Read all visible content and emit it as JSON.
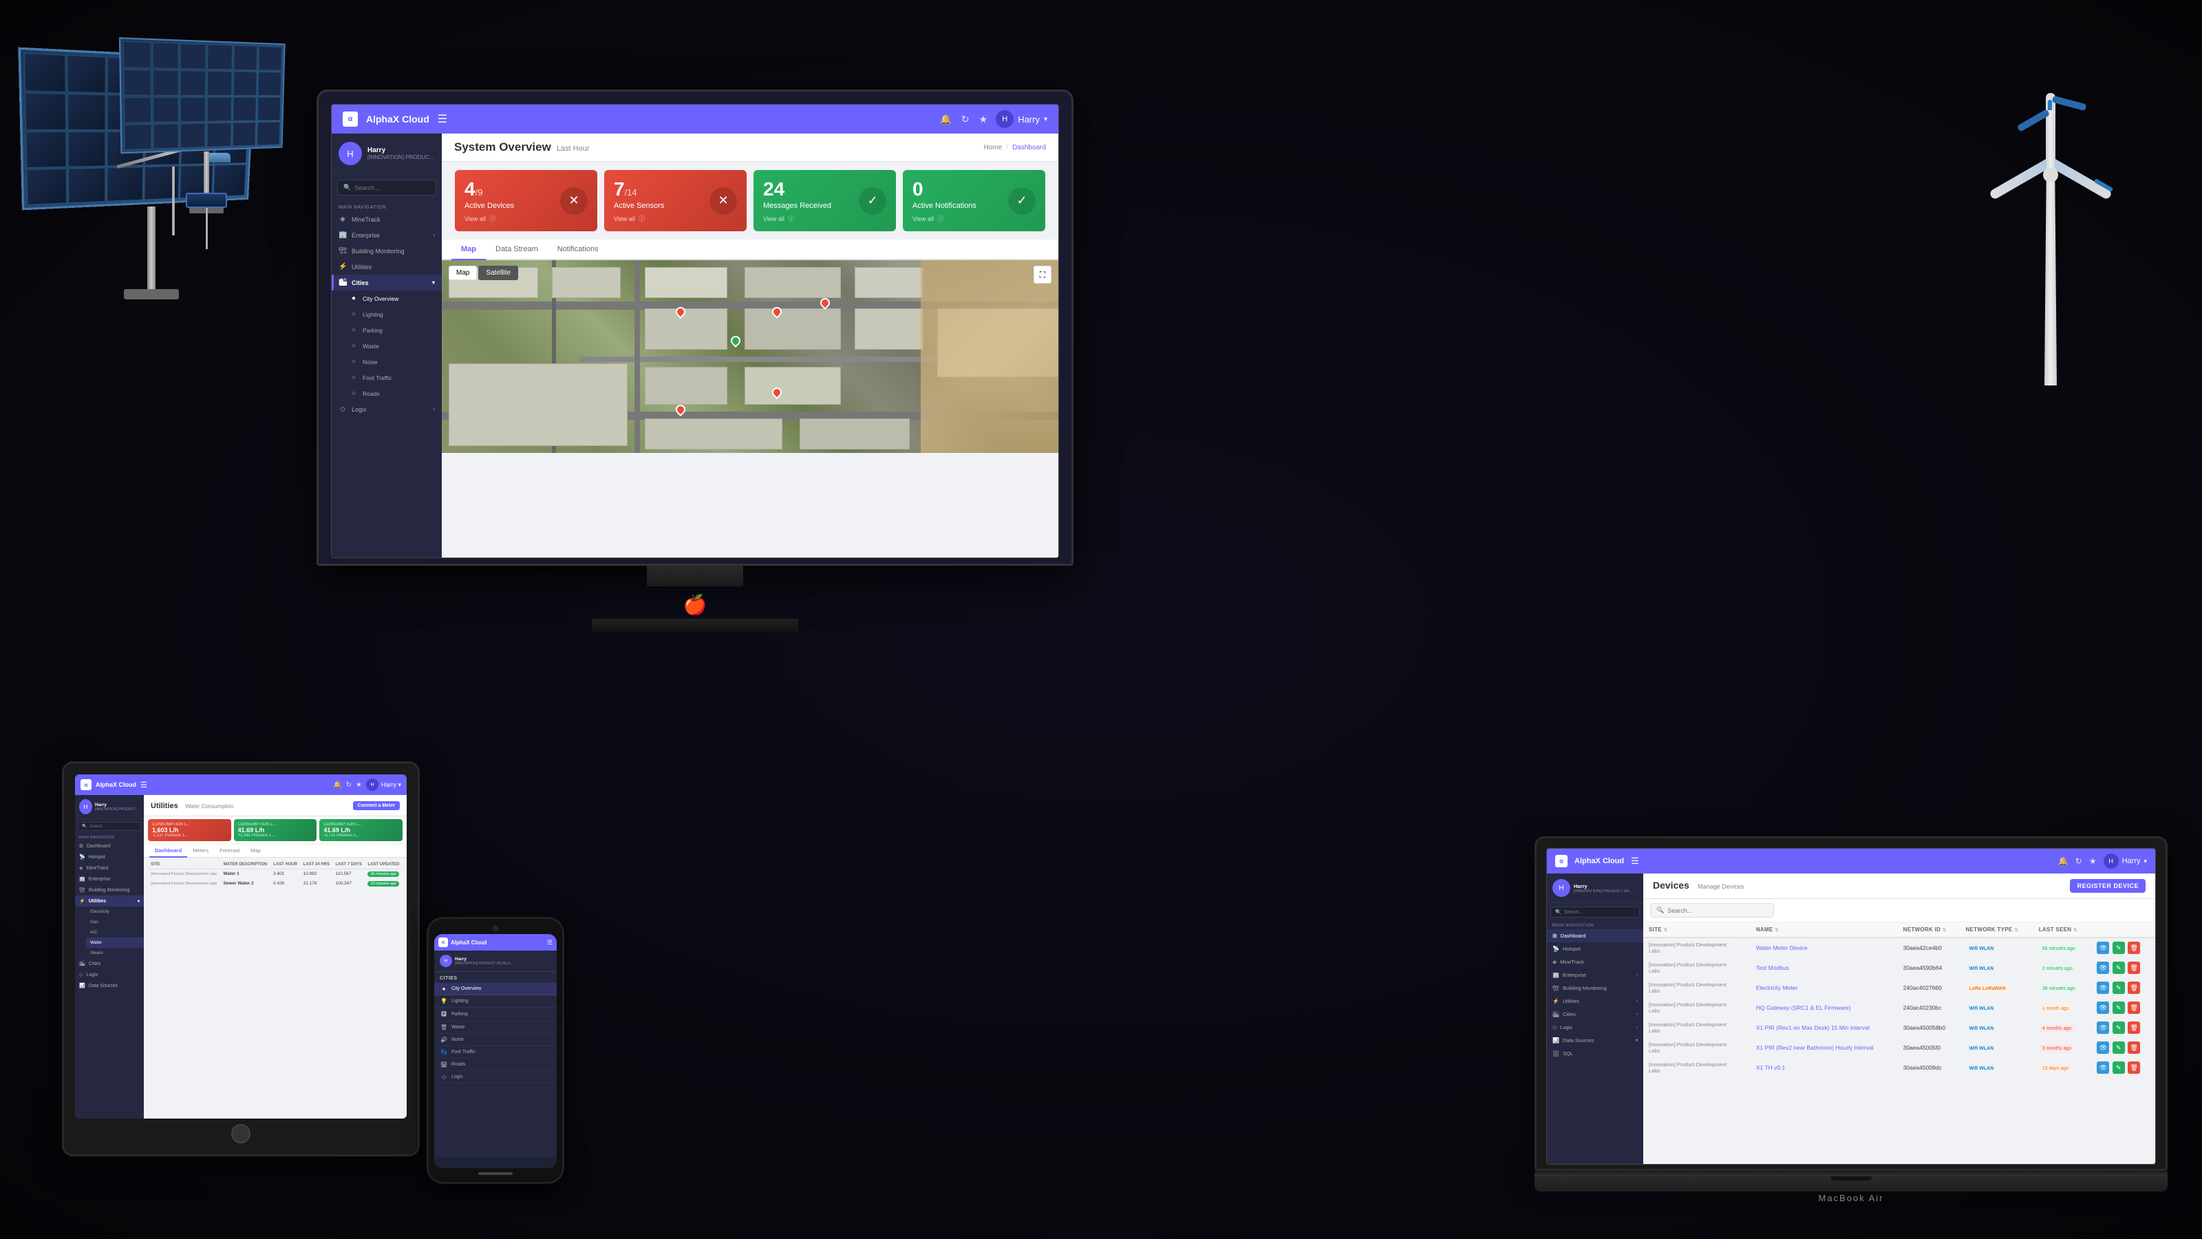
{
  "app": {
    "brand": "AlphaX Cloud",
    "logo_letter": "α",
    "user": "Harry",
    "menu_icon": "☰",
    "bell_icon": "🔔",
    "refresh_icon": "↻",
    "star_icon": "★",
    "search_placeholder": "Search..."
  },
  "monitor": {
    "page_title": "System Overview",
    "page_subtitle": "Last Hour",
    "breadcrumb": {
      "home": "Home",
      "current": "Dashboard"
    },
    "stat_cards": [
      {
        "number": "4",
        "denom": "/9",
        "label": "Active Devices",
        "view_all": "View all",
        "type": "red",
        "icon": "✕"
      },
      {
        "number": "7",
        "denom": "/14",
        "label": "Active Sensors",
        "view_all": "View all",
        "type": "red",
        "icon": "✕"
      },
      {
        "number": "24",
        "denom": "",
        "label": "Messages Received",
        "view_all": "View all",
        "type": "green",
        "icon": "✓"
      },
      {
        "number": "0",
        "denom": "",
        "label": "Active Notifications",
        "view_all": "View all",
        "type": "green",
        "icon": "✓"
      }
    ],
    "tabs": [
      "Map",
      "Data Stream",
      "Notifications"
    ],
    "active_tab": "Map",
    "map_tabs": [
      "Map",
      "Satellite"
    ],
    "active_map_tab": "Satellite",
    "sidebar": {
      "profile_name": "Harry",
      "profile_org": "[INNOVATION] PRODUCT DEVELO...",
      "nav_items": [
        {
          "label": "MineTrack",
          "icon": "◈"
        },
        {
          "label": "Enterprise",
          "icon": "🏢",
          "has_arrow": true
        },
        {
          "label": "Building Monitoring",
          "icon": "🏗"
        },
        {
          "label": "Utilities",
          "icon": "⚡"
        },
        {
          "label": "Cities",
          "icon": "🏙",
          "active": true,
          "has_arrow": true
        },
        {
          "label": "City Overview",
          "icon": "●",
          "sub": true,
          "active_sub": true
        },
        {
          "label": "Lighting",
          "icon": "○",
          "sub": true
        },
        {
          "label": "Parking",
          "icon": "○",
          "sub": true
        },
        {
          "label": "Waste",
          "icon": "○",
          "sub": true
        },
        {
          "label": "Noise",
          "icon": "○",
          "sub": true
        },
        {
          "label": "Foot Traffic",
          "icon": "○",
          "sub": true
        },
        {
          "label": "Roads",
          "icon": "○",
          "sub": true
        },
        {
          "label": "Logix",
          "icon": "◇",
          "has_arrow": true
        }
      ],
      "nav_label": "MAIN NAVIGATION"
    }
  },
  "laptop": {
    "page_title": "Devices",
    "page_subtitle": "Manage Devices",
    "register_btn": "REGISTER DEVICE",
    "table_headers": [
      "Site",
      "Name",
      "Network ID",
      "Network Type",
      "Last Seen",
      ""
    ],
    "devices": [
      {
        "site": "[Innovation] Product Development Labs",
        "name": "Water Meter Device",
        "network_id": "30aea42ce4b0",
        "network_type": "Wifi WLAN",
        "network_type_badge": "wifi",
        "last_seen": "56 minutes ago",
        "last_seen_type": "green"
      },
      {
        "site": "[Innovation] Product Development Labs",
        "name": "Test Modbus",
        "network_id": "30aea4590b64",
        "network_type": "Wifi WLAN",
        "network_type_badge": "wifi",
        "last_seen": "2 minutes ago",
        "last_seen_type": "green"
      },
      {
        "site": "[Innovation] Product Development Labs",
        "name": "Electricity Meter",
        "network_id": "240ac4027660",
        "network_type": "LoRa LoRaWAN",
        "network_type_badge": "lora",
        "last_seen": "38 minutes ago",
        "last_seen_type": "green"
      },
      {
        "site": "[Innovation] Product Development Labs",
        "name": "HQ Gateway (SRC1 & EL Firmware)",
        "network_id": "240ac40230bc",
        "network_type": "Wifi WLAN",
        "network_type_badge": "wifi",
        "last_seen": "1 month ago",
        "last_seen_type": "orange"
      },
      {
        "site": "[Innovation] Product Development Labs",
        "name": "X1 PIR (Rev1 on Max Desk) 15 Min Interval",
        "network_id": "30aea450058b0",
        "network_type": "Wifi WLAN",
        "network_type_badge": "wifi",
        "last_seen": "4 months ago",
        "last_seen_type": "red"
      },
      {
        "site": "[Innovation] Product Development Labs",
        "name": "X1 PIR (Rev2 near Bathroom) Hourly Interval",
        "network_id": "30aea45005f0",
        "network_type": "Wifi WLAN",
        "network_type_badge": "wifi",
        "last_seen": "3 months ago",
        "last_seen_type": "red"
      },
      {
        "site": "[Innovation] Product Development Labs",
        "name": "X1 TH v0.1",
        "network_id": "30aea45009dc",
        "network_type": "Wifi WLAN",
        "network_type_badge": "wifi",
        "last_seen": "13 days ago",
        "last_seen_type": "orange"
      }
    ],
    "sidebar": {
      "profile_name": "Harry",
      "profile_org": "[INNOVATION] PRODUCT DEVE...",
      "nav_items": [
        {
          "label": "Dashboard",
          "icon": "⊞",
          "active": true
        },
        {
          "label": "Hotspot",
          "icon": "📡"
        },
        {
          "label": "MineTrack",
          "icon": "◈"
        },
        {
          "label": "Enterprise",
          "icon": "🏢",
          "has_arrow": true
        },
        {
          "label": "Building Monitoring",
          "icon": "🏗"
        },
        {
          "label": "Utilities",
          "icon": "⚡",
          "has_arrow": true
        },
        {
          "label": "Cities",
          "icon": "🏙",
          "has_arrow": true
        },
        {
          "label": "Logix",
          "icon": "◇",
          "has_arrow": true
        },
        {
          "label": "Data Sources",
          "icon": "📊",
          "has_arrow": true
        },
        {
          "label": "SQL",
          "icon": "🗄"
        }
      ]
    }
  },
  "tablet": {
    "page_title": "Utilities",
    "page_subtitle": "Water Consumption",
    "connect_meter_btn": "Connect a Meter",
    "tabs": [
      "Dashboard",
      "Meters",
      "Forecast",
      "Map"
    ],
    "active_tab": "Dashboard",
    "consumption_cards": [
      {
        "label": "CONSUMPTION L...",
        "value": "1,603 L/h",
        "prev": "-1.227 Previous 1...",
        "type": "red"
      },
      {
        "label": "CONSUMPTION L...",
        "value": "41.69 L/h",
        "prev": "+1.381 Previous 1...",
        "type": "green"
      },
      {
        "label": "CONSUMPTION L...",
        "value": "41.69 L/h",
        "prev": "-5.715 Previous 1...",
        "type": "green"
      }
    ],
    "water_tabs": [
      "Dashboard",
      "Meters",
      "Forecast",
      "Map"
    ],
    "table_headers": [
      "Site",
      "Water Description",
      "Last Hour",
      "Last 24 Hrs",
      "Last 7 Days",
      "Last Updated"
    ],
    "water_rows": [
      {
        "site": "[Innovation] Product Development Labs",
        "description": "Water 1",
        "last_hour": "3.601",
        "last_24h": "10.982",
        "last_7d": "110,567",
        "last_updated": "26 minutes ago"
      },
      {
        "site": "[Innovation] Product Development Labs",
        "description": "Sewer Water 2",
        "last_hour": "0.430",
        "last_24h": "31.178",
        "last_7d": "100,347",
        "last_updated": "23 minutes ago"
      }
    ],
    "sidebar": {
      "profile_name": "Harry",
      "profile_org": "[INNOVATION] PRODUCT DEVELO...",
      "nav_items": [
        {
          "label": "Dashboard",
          "icon": "⊞"
        },
        {
          "label": "Hotspot",
          "icon": "📡"
        },
        {
          "label": "MineTrack",
          "icon": "◈"
        },
        {
          "label": "Enterprise",
          "icon": "🏢"
        },
        {
          "label": "Building Monitoring",
          "icon": "🏗"
        },
        {
          "label": "Utilities",
          "icon": "⚡",
          "active": true,
          "sub_items": [
            "Electricity",
            "Gas",
            "A/C",
            "Water",
            "Steam"
          ]
        },
        {
          "label": "Cities",
          "icon": "🏙"
        },
        {
          "label": "Logix",
          "icon": "◇"
        },
        {
          "label": "Data Sources",
          "icon": "📊"
        }
      ]
    }
  },
  "phone": {
    "brand": "AlphaX Cloud",
    "user": "Harry",
    "nav_items": [
      {
        "label": "Cities",
        "icon": "🏙",
        "is_section": true
      },
      {
        "label": "City Overview",
        "icon": "●",
        "active": true
      },
      {
        "label": "Lighting",
        "icon": "💡"
      },
      {
        "label": "Parking",
        "icon": "🅿"
      },
      {
        "label": "Waste",
        "icon": "🗑"
      },
      {
        "label": "Noise",
        "icon": "🔊"
      },
      {
        "label": "Foot Traffic",
        "icon": "👣"
      },
      {
        "label": "Roads",
        "icon": "🛣"
      },
      {
        "label": "Logix",
        "icon": "◇"
      }
    ]
  },
  "icons": {
    "alpha": "α",
    "bell": "🔔",
    "refresh": "↻",
    "star": "★",
    "search": "🔍",
    "chevron_right": "›",
    "chevron_down": "▾",
    "fullscreen": "⛶",
    "check": "✓",
    "cross": "✕",
    "sort": "⇅",
    "eye": "👁",
    "edit": "✎",
    "trash": "🗑"
  },
  "colors": {
    "primary": "#6c63ff",
    "red": "#e74c3c",
    "green": "#27ae60",
    "dark_bg": "#252840",
    "light_bg": "#f0f2f5"
  }
}
